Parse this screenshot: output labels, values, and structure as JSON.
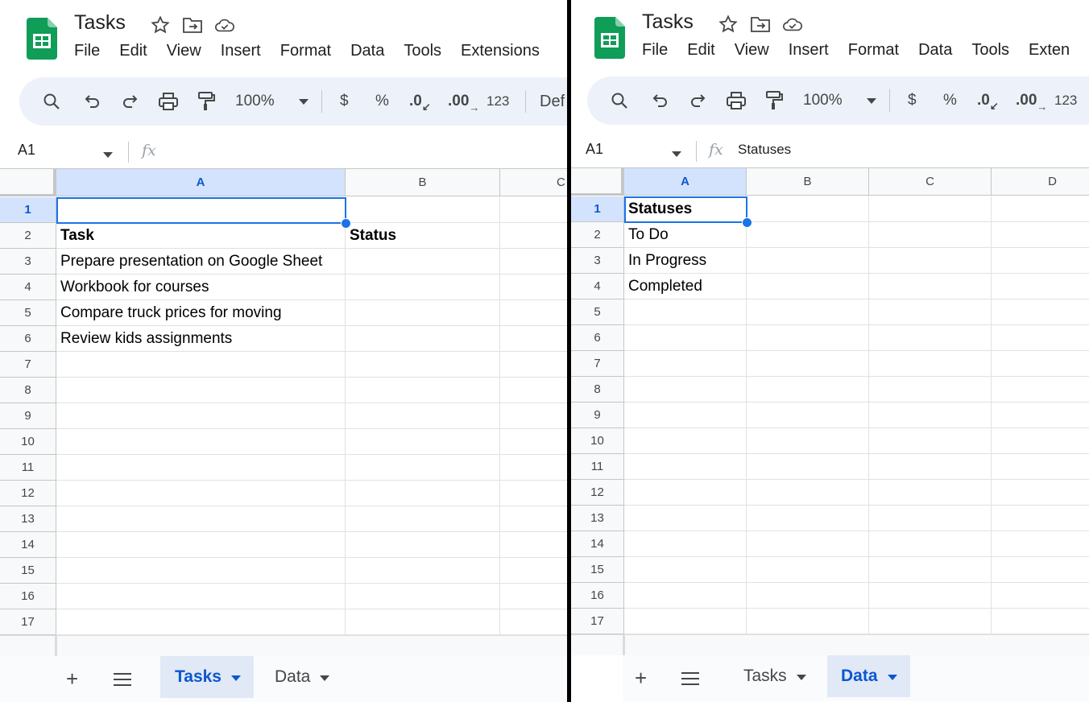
{
  "left": {
    "title": "Tasks",
    "menu": [
      "File",
      "Edit",
      "View",
      "Insert",
      "Format",
      "Data",
      "Tools",
      "Extensions"
    ],
    "toolbar": {
      "zoom": "100%",
      "currency": "$",
      "percent": "%",
      "dec_decrease": ".0",
      "dec_increase": ".00",
      "number_format": "123",
      "font_cut": "Def"
    },
    "name_box": "A1",
    "formula_value": "",
    "columns": [
      "A",
      "B",
      "C"
    ],
    "rows": [
      "1",
      "2",
      "3",
      "4",
      "5",
      "6",
      "7",
      "8",
      "9",
      "10",
      "11",
      "12",
      "13",
      "14",
      "15",
      "16",
      "17"
    ],
    "cells": {
      "A2": "Task",
      "B2": "Status",
      "A3": "Prepare presentation on Google Sheet",
      "A4": "Workbook for courses",
      "A5": "Compare truck prices for moving",
      "A6": "Review kids assignments"
    },
    "tabs": [
      {
        "label": "Tasks",
        "active": true
      },
      {
        "label": "Data",
        "active": false
      }
    ]
  },
  "right": {
    "title": "Tasks",
    "menu": [
      "File",
      "Edit",
      "View",
      "Insert",
      "Format",
      "Data",
      "Tools",
      "Exten"
    ],
    "toolbar": {
      "zoom": "100%",
      "currency": "$",
      "percent": "%",
      "dec_decrease": ".0",
      "dec_increase": ".00",
      "number_format": "123"
    },
    "name_box": "A1",
    "formula_value": "Statuses",
    "columns": [
      "A",
      "B",
      "C",
      "D"
    ],
    "rows": [
      "1",
      "2",
      "3",
      "4",
      "5",
      "6",
      "7",
      "8",
      "9",
      "10",
      "11",
      "12",
      "13",
      "14",
      "15",
      "16",
      "17"
    ],
    "cells": {
      "A1": "Statuses",
      "A2": "To Do",
      "A3": "In Progress",
      "A4": "Completed"
    },
    "tabs": [
      {
        "label": "Tasks",
        "active": false
      },
      {
        "label": "Data",
        "active": true
      }
    ]
  },
  "colors": {
    "accent": "#1a73e8",
    "sheets_green": "#0f9d58",
    "selection_header": "#d3e3fd",
    "toolbar_bg": "#edf2fa"
  },
  "icons": [
    "sheets-logo-icon",
    "star-icon",
    "move-folder-icon",
    "cloud-saved-icon",
    "search-icon",
    "undo-icon",
    "redo-icon",
    "print-icon",
    "paint-format-icon",
    "chevron-down-icon",
    "fx-icon",
    "add-sheet-icon",
    "all-sheets-icon"
  ]
}
